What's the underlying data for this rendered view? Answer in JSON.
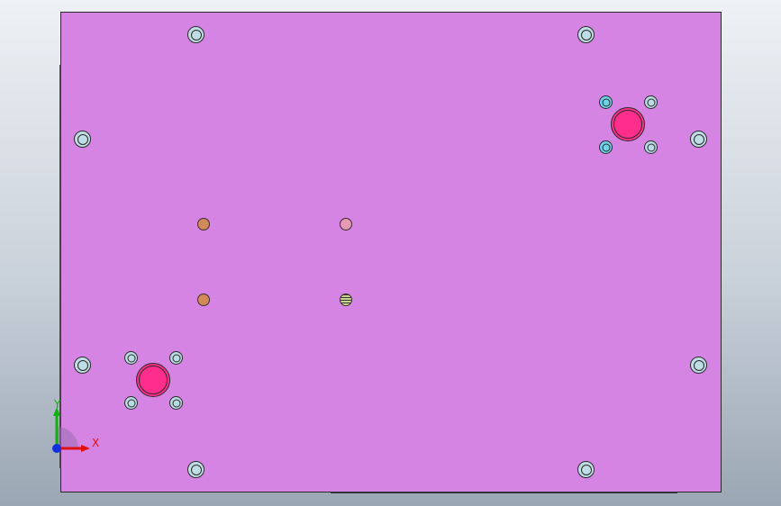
{
  "colors": {
    "plate_face": "#d684e4",
    "mounting_hole_fill": "#bfdde4",
    "cbore_hole_fill": "#ff2d8c",
    "small_hole_cyan": "#6ed3ea",
    "small_hole_light": "#b9dbe4",
    "pin_orange": "#d38a5a",
    "pin_pink": "#e79ab6",
    "threaded_hole": "#c8d48e",
    "axis_x": "#e01010",
    "axis_y": "#10b010",
    "axis_z": "#1030e0"
  },
  "triad": {
    "x_label": "X",
    "y_label": "Y"
  },
  "features": {
    "mounting_holes": 8,
    "counterbored_holes": 2,
    "small_holes": 8,
    "dowel_pins": 4
  }
}
